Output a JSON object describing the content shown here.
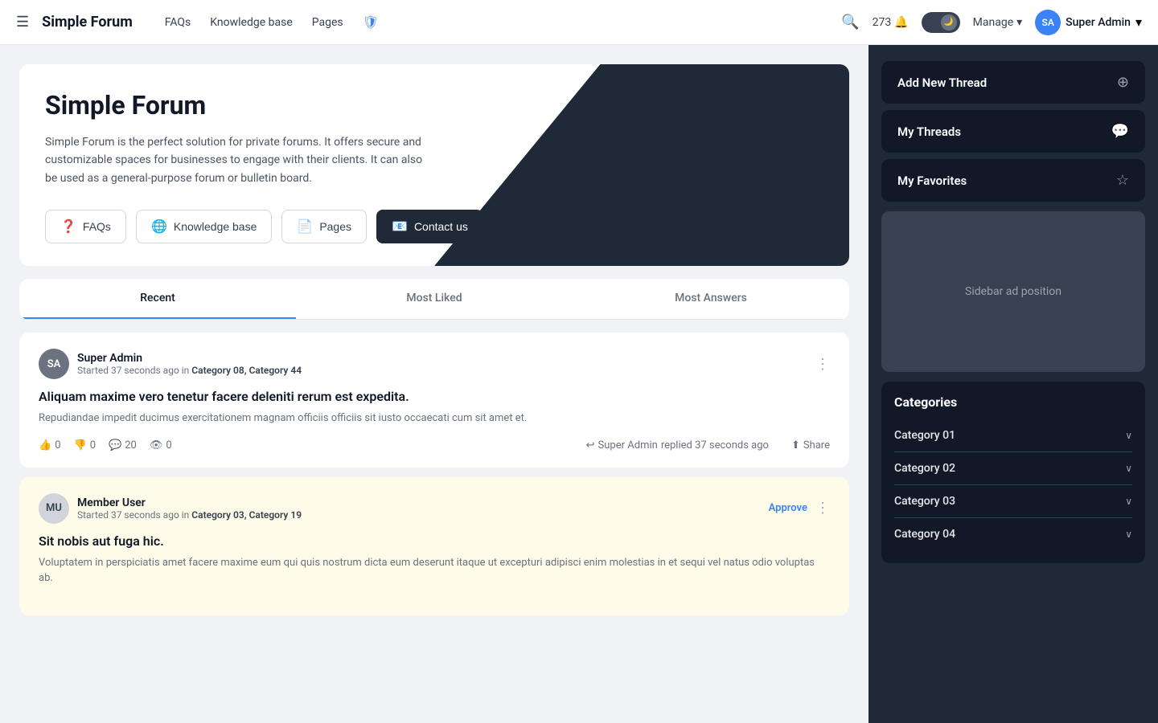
{
  "navbar": {
    "brand": "Simple Forum",
    "links": [
      "FAQs",
      "Knowledge base",
      "Pages"
    ],
    "shield_icon": "🛡",
    "notification_count": "273",
    "toggle_icon": "🌙",
    "manage_label": "Manage",
    "user_initials": "SA",
    "user_name": "Super Admin"
  },
  "hero": {
    "title": "Simple Forum",
    "description": "Simple Forum is the perfect solution for private forums. It offers secure and customizable spaces for businesses to engage with their clients. It can also be used as a general-purpose forum or bulletin board.",
    "buttons": [
      {
        "icon": "❓",
        "label": "FAQs",
        "active": false
      },
      {
        "icon": "🌐",
        "label": "Knowledge base",
        "active": false
      },
      {
        "icon": "📄",
        "label": "Pages",
        "active": false
      },
      {
        "icon": "📧",
        "label": "Contact us",
        "active": true
      }
    ]
  },
  "tabs": [
    {
      "label": "Recent",
      "active": true
    },
    {
      "label": "Most Liked",
      "active": false
    },
    {
      "label": "Most Answers",
      "active": false
    }
  ],
  "threads": [
    {
      "id": "thread-1",
      "author_initials": "SA",
      "author_name": "Super Admin",
      "avatar_class": "avatar-sa",
      "meta": "Started 37 seconds ago in",
      "categories": "Category 08, Category 44",
      "title": "Aliquam maxime vero tenetur facere deleniti rerum est expedita.",
      "excerpt": "Repudiandae impedit ducimus exercitationem magnam officiis officiis sit iusto occaecati cum sit amet et.",
      "likes": "0",
      "dislikes": "0",
      "comments": "20",
      "views": "0",
      "reply_user": "Super Admin",
      "reply_time": "replied 37 seconds ago",
      "share_label": "Share",
      "highlighted": false,
      "show_approve": false
    },
    {
      "id": "thread-2",
      "author_initials": "MU",
      "author_name": "Member User",
      "avatar_class": "avatar-mu",
      "meta": "Started 37 seconds ago in",
      "categories": "Category 03, Category 19",
      "title": "Sit nobis aut fuga hic.",
      "excerpt": "Voluptatem in perspiciatis amet facere maxime eum qui quis nostrum dicta eum deserunt itaque ut excepturi adipisci enim molestias in et sequi vel natus odio voluptas ab.",
      "likes": "",
      "dislikes": "",
      "comments": "",
      "views": "",
      "reply_user": "",
      "reply_time": "",
      "share_label": "",
      "highlighted": true,
      "show_approve": true,
      "approve_label": "Approve"
    }
  ],
  "sidebar": {
    "add_thread_label": "Add New Thread",
    "add_thread_icon": "⊕",
    "my_threads_label": "My Threads",
    "my_threads_icon": "💬",
    "my_favorites_label": "My Favorites",
    "my_favorites_icon": "☆",
    "ad_label": "Sidebar ad position",
    "categories_title": "Categories",
    "categories": [
      {
        "name": "Category 01",
        "icon": "˅"
      },
      {
        "name": "Category 02",
        "icon": "˅"
      },
      {
        "name": "Category 03",
        "icon": "˅"
      },
      {
        "name": "Category 04",
        "icon": "˅"
      }
    ]
  }
}
